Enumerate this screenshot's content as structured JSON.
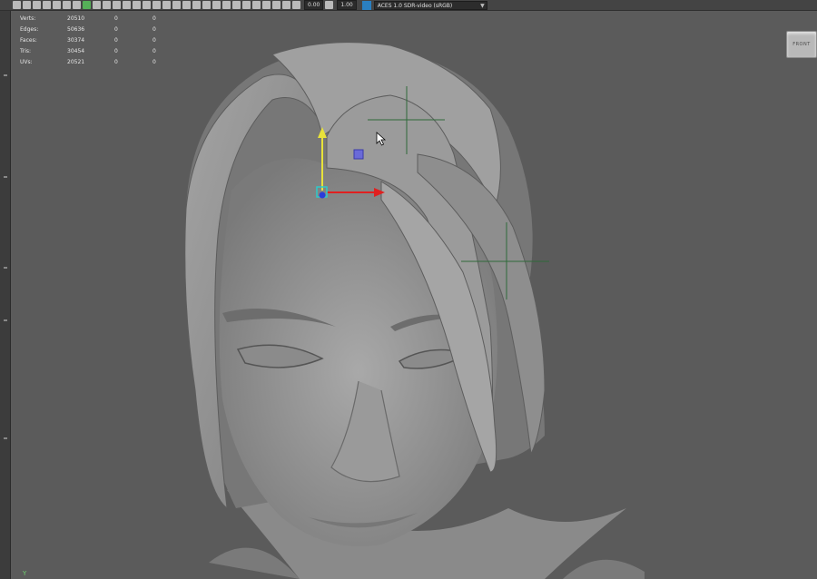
{
  "stats": [
    {
      "label": "Verts:",
      "total": "20510",
      "selected": "0",
      "triangles": "0"
    },
    {
      "label": "Edges:",
      "total": "50636",
      "selected": "0",
      "triangles": "0"
    },
    {
      "label": "Faces:",
      "total": "30374",
      "selected": "0",
      "triangles": "0"
    },
    {
      "label": "Tris:",
      "total": "30454",
      "selected": "0",
      "triangles": "0"
    },
    {
      "label": "UVs:",
      "total": "20521",
      "selected": "0",
      "triangles": "0"
    }
  ],
  "toolbar": {
    "exposure_value": "0.00",
    "gamma_value": "1.00",
    "color_management": "ACES 1.0 SDR-video (sRGB)"
  },
  "viewcube": {
    "face_label": "FRONT"
  },
  "axis_indicator": {
    "label": "Y"
  },
  "colors": {
    "viewport_bg": "#5b5b5b",
    "gizmo_y": "#e8e23a",
    "gizmo_x": "#e02020",
    "gizmo_center": "#2a3cdc",
    "pivot": "#6a6ad8",
    "crosshair": "#2f6a3a"
  },
  "icons": [
    "select-icon",
    "move-icon",
    "rotate-icon",
    "scale-icon",
    "snap-icon",
    "camera-icon",
    "grid-icon",
    "wireframe-icon",
    "shaded-icon",
    "texture-icon",
    "light-icon",
    "shadow-icon",
    "xray-icon",
    "isolate-icon",
    "resolution-gate-icon"
  ]
}
